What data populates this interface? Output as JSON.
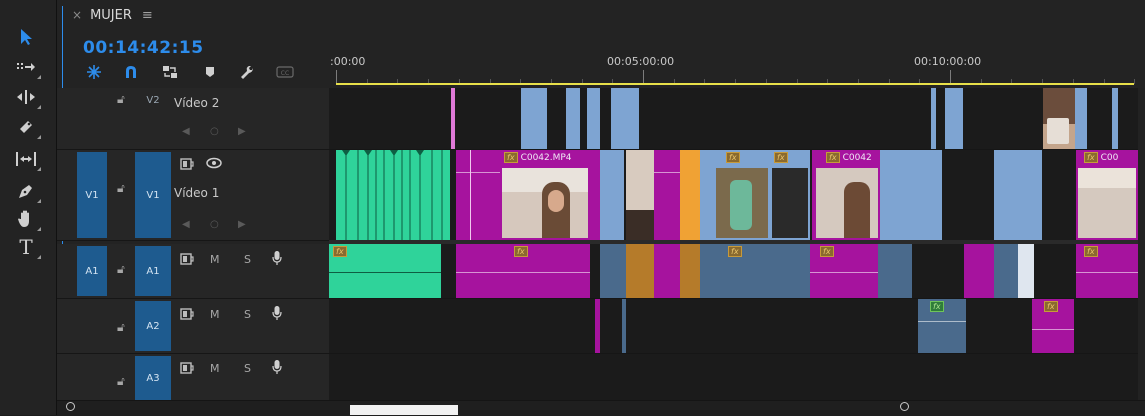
{
  "sequence": {
    "tab_close": "×",
    "name": "MUJER",
    "menu_glyph": "≡",
    "timecode": "00:14:42:15"
  },
  "ruler": {
    "labels": [
      ":00:00",
      "00:05:00:00",
      "00:10:00:00"
    ]
  },
  "tracks": {
    "v2": {
      "target": "V2",
      "name": "Vídeo 2"
    },
    "v1": {
      "source": "V1",
      "target": "V1",
      "name": "Vídeo 1"
    },
    "a1": {
      "source": "A1",
      "target": "A1",
      "m": "M",
      "s": "S"
    },
    "a2": {
      "target": "A2",
      "m": "M",
      "s": "S"
    },
    "a3": {
      "target": "A3",
      "m": "M",
      "s": "S"
    }
  },
  "clips": {
    "c0042_mp4": "C0042.MP4",
    "c0042": "C0042",
    "c00": "C00",
    "fx": "fx"
  },
  "toolbar_icons": [
    "selection-tool-icon",
    "track-select-forward-icon",
    "ripple-edit-icon",
    "razor-icon",
    "slip-icon",
    "pen-icon",
    "hand-icon",
    "type-icon"
  ],
  "timeline_icons": [
    "nest-sequence-icon",
    "snap-magnet-icon",
    "linked-selection-icon",
    "add-marker-icon",
    "timeline-settings-wrench-icon",
    "captions-icon"
  ],
  "colors": {
    "accent_blue": "#2d8ceb",
    "clip_magenta": "#a6139e",
    "clip_teal": "#2fd39a",
    "clip_light_blue": "#7ea4d2",
    "clip_orange": "#f0a234",
    "clip_pink": "#e07ad7",
    "work_area_yellow": "#e8e04a"
  }
}
